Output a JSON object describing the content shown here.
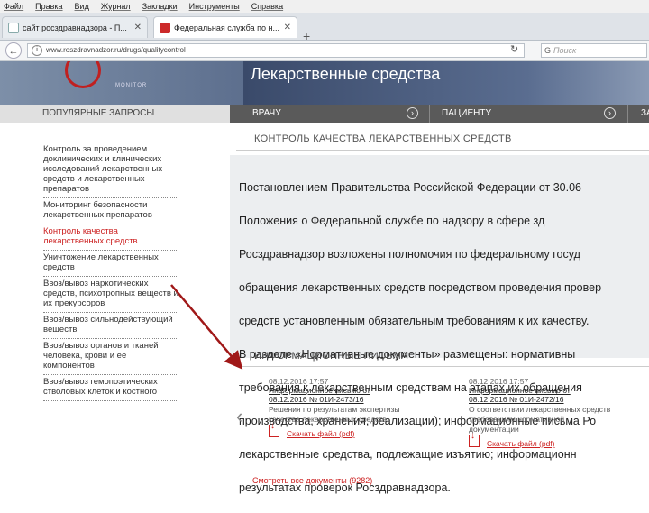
{
  "menubar": {
    "items": [
      "Файл",
      "Правка",
      "Вид",
      "Журнал",
      "Закладки",
      "Инструменты",
      "Справка"
    ]
  },
  "tabs": [
    {
      "label": "сайт росздравнадзора - П..."
    },
    {
      "label": "Федеральная служба по н..."
    }
  ],
  "toolbar": {
    "url": "www.roszdravnadzor.ru/drugs/qualitycontrol",
    "search_placeholder": "Поиск",
    "search_engine_icon": "G"
  },
  "banner": {
    "title": "Лекарственные средства",
    "monitor_label": "MONITOR"
  },
  "nav": {
    "popular": "ПОПУЛЯРНЫЕ ЗАПРОСЫ",
    "doctor": "ВРАЧУ",
    "patient": "ПАЦИЕНТУ",
    "extra": "ЗА"
  },
  "sidebar": {
    "items": [
      {
        "label": "Контроль за проведением доклинических и клинических исследований лекарственных средств и лекарственных препаратов",
        "active": false
      },
      {
        "label": "Мониторинг безопасности лекарственных препаратов",
        "active": false
      },
      {
        "label": "Контроль качества лекарственных средств",
        "active": true
      },
      {
        "label": "Уничтожение лекарственных средств",
        "active": false
      },
      {
        "label": "Ввоз/вывоз наркотических средств, психотропных веществ и их прекурсоров",
        "active": false
      },
      {
        "label": "Ввоз/вывоз сильнодействующий веществ",
        "active": false
      },
      {
        "label": "Ввоз/вывоз органов и тканей человека, крови и ее компонентов",
        "active": false
      },
      {
        "label": "Ввоз/вывоз гемопоэтических стволовых клеток и костного",
        "active": false
      }
    ]
  },
  "main": {
    "section_title": "КОНТРОЛЬ КАЧЕСТВА ЛЕКАРСТВЕННЫХ СРЕДСТВ",
    "text_lines": [
      "Постановлением Правительства Российской Федерации от 30.06",
      "Положения о Федеральной службе по надзору в сфере зд",
      "Росздравнадзор возложены полномочия по федеральному госуд",
      "обращения лекарственных средств посредством проведения провер",
      "средств установленным обязательным требованиям к их качеству.",
      "В разделе «Нормативные документы» размещены: нормативны",
      "требования к лекарственным средствам на этапах их обращения",
      "производства, хранения, реализации); информационные письма Ро",
      "лекарственные средства, подлежащие изъятию; информационн",
      "результатах проверок Росздравнадзора."
    ],
    "letters_title": "ИНФОРМАЦИОННЫЕ ПИСЬМА",
    "letters": [
      {
        "date": "08.12.2016 17:57",
        "title_line1": "Информационное письмо от",
        "title_line2": "08.12.2016 № 01И-2473/16",
        "desc_line1": "Решения по результатам экспертизы",
        "desc_line2": "качества лекарственных средств",
        "download": "Скачать файл (pdf)"
      },
      {
        "date": "08.12.2016 17:57",
        "title_line1": "Информационное письмо от",
        "title_line2": "08.12.2016 № 01И-2472/16",
        "desc_line1": "О соответствии лекарственных средств",
        "desc_line2": "требованиям нормативной",
        "desc_line3": "документации",
        "download": "Скачать файл (pdf)"
      }
    ],
    "see_all": "Смотреть все документы (9282)"
  }
}
